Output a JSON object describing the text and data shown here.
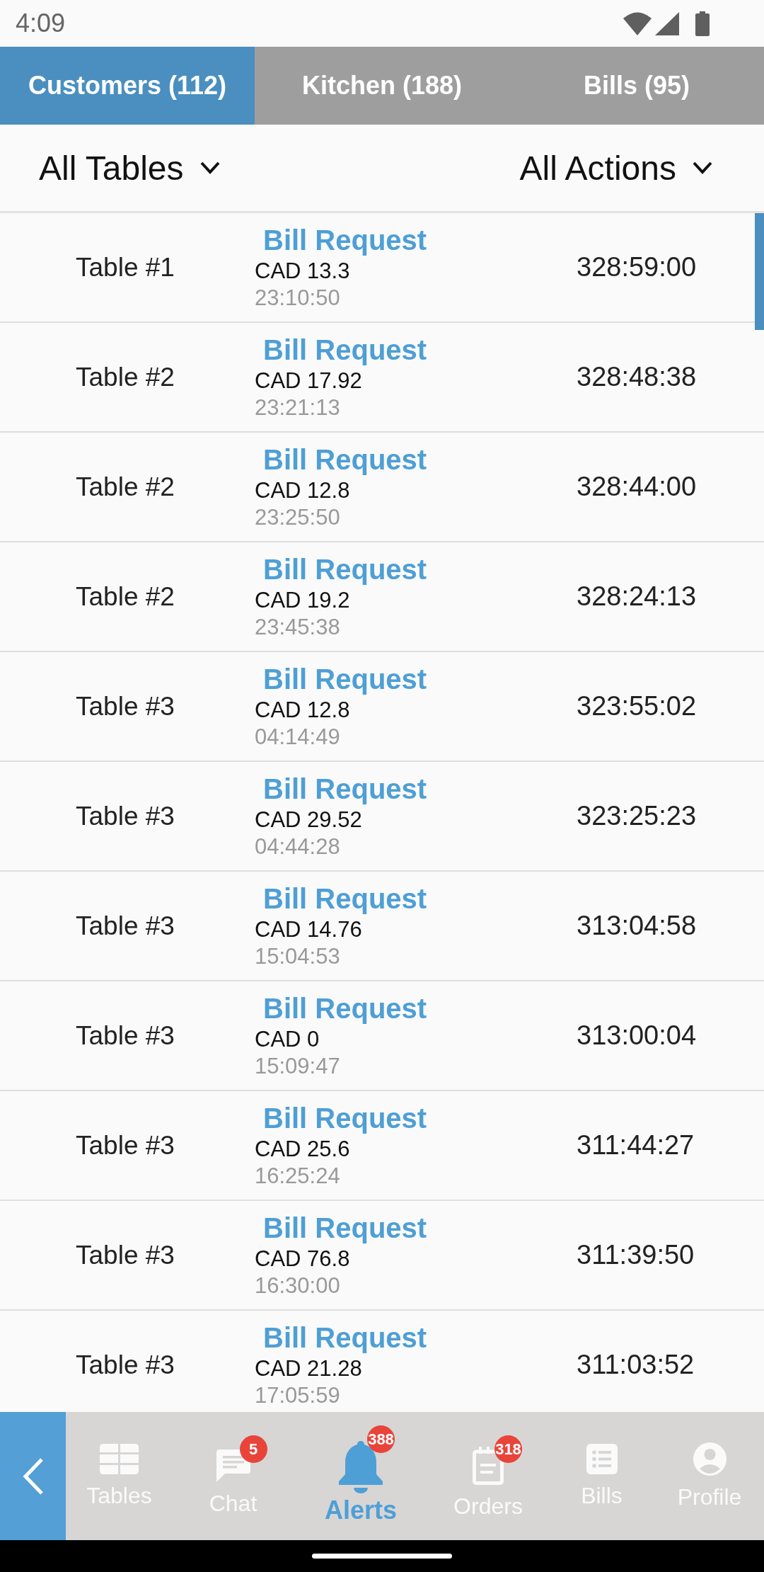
{
  "status_bar": {
    "time": "4:09"
  },
  "tabs": [
    {
      "label": "Customers (112)",
      "selected": true
    },
    {
      "label": "Kitchen (188)",
      "selected": false
    },
    {
      "label": "Bills (95)",
      "selected": false
    }
  ],
  "filters": [
    {
      "label": "All Tables"
    },
    {
      "label": "All Actions"
    }
  ],
  "alerts": [
    {
      "table": "Table #1",
      "action": "Bill Request",
      "amount": "CAD 13.3",
      "time": "23:10:50",
      "elapsed": "328:59:00"
    },
    {
      "table": "Table #2",
      "action": "Bill Request",
      "amount": "CAD 17.92",
      "time": "23:21:13",
      "elapsed": "328:48:38"
    },
    {
      "table": "Table #2",
      "action": "Bill Request",
      "amount": "CAD 12.8",
      "time": "23:25:50",
      "elapsed": "328:44:00"
    },
    {
      "table": "Table #2",
      "action": "Bill Request",
      "amount": "CAD 19.2",
      "time": "23:45:38",
      "elapsed": "328:24:13"
    },
    {
      "table": "Table #3",
      "action": "Bill Request",
      "amount": "CAD 12.8",
      "time": "04:14:49",
      "elapsed": "323:55:02"
    },
    {
      "table": "Table #3",
      "action": "Bill Request",
      "amount": "CAD 29.52",
      "time": "04:44:28",
      "elapsed": "323:25:23"
    },
    {
      "table": "Table #3",
      "action": "Bill Request",
      "amount": "CAD 14.76",
      "time": "15:04:53",
      "elapsed": "313:04:58"
    },
    {
      "table": "Table #3",
      "action": "Bill Request",
      "amount": "CAD 0",
      "time": "15:09:47",
      "elapsed": "313:00:04"
    },
    {
      "table": "Table #3",
      "action": "Bill Request",
      "amount": "CAD 25.6",
      "time": "16:25:24",
      "elapsed": "311:44:27"
    },
    {
      "table": "Table #3",
      "action": "Bill Request",
      "amount": "CAD 76.8",
      "time": "16:30:00",
      "elapsed": "311:39:50"
    },
    {
      "table": "Table #3",
      "action": "Bill Request",
      "amount": "CAD 21.28",
      "time": "17:05:59",
      "elapsed": "311:03:52"
    }
  ],
  "bottom_nav": {
    "items": [
      {
        "label": "Tables",
        "selected": false
      },
      {
        "label": "Chat",
        "selected": false,
        "badge": "5"
      },
      {
        "label": "Alerts",
        "selected": true,
        "badge": "388"
      },
      {
        "label": "Orders",
        "selected": false,
        "badge": "318"
      },
      {
        "label": "Bills",
        "selected": false
      },
      {
        "label": "Profile",
        "selected": false
      }
    ]
  }
}
